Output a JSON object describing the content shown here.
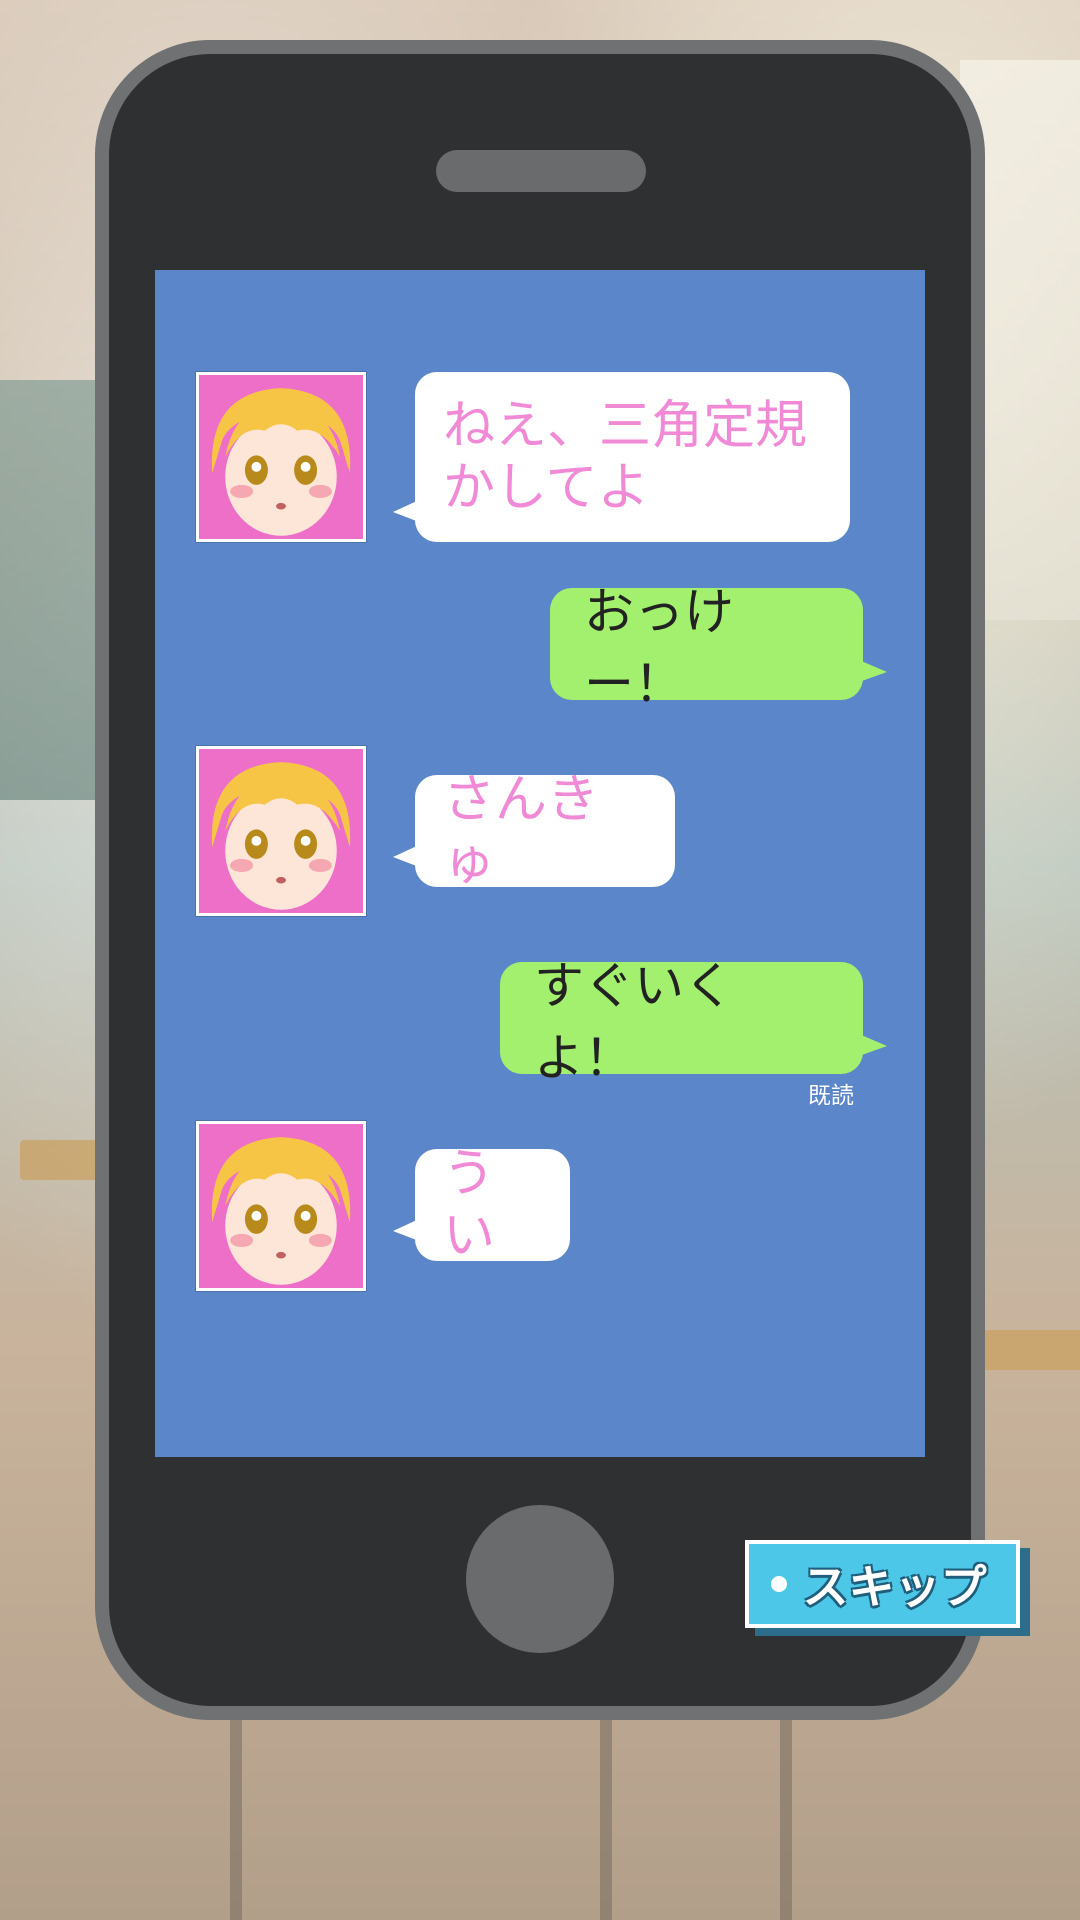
{
  "chat": {
    "messages": [
      {
        "sender": "friend",
        "text": "ねえ、三角定規\nかしてよ"
      },
      {
        "sender": "me",
        "text": "おっけー！"
      },
      {
        "sender": "friend",
        "text": "さんきゅ"
      },
      {
        "sender": "me",
        "text": "すぐいくよ！"
      },
      {
        "sender": "friend",
        "text": "うい"
      }
    ],
    "read_receipt": "既読"
  },
  "skip_button": {
    "label": "スキップ"
  },
  "colors": {
    "screen": "#5b86c9",
    "friend_text": "#f08ad6",
    "my_bubble": "#a3f06e",
    "skip_button": "#4cc7e8"
  }
}
